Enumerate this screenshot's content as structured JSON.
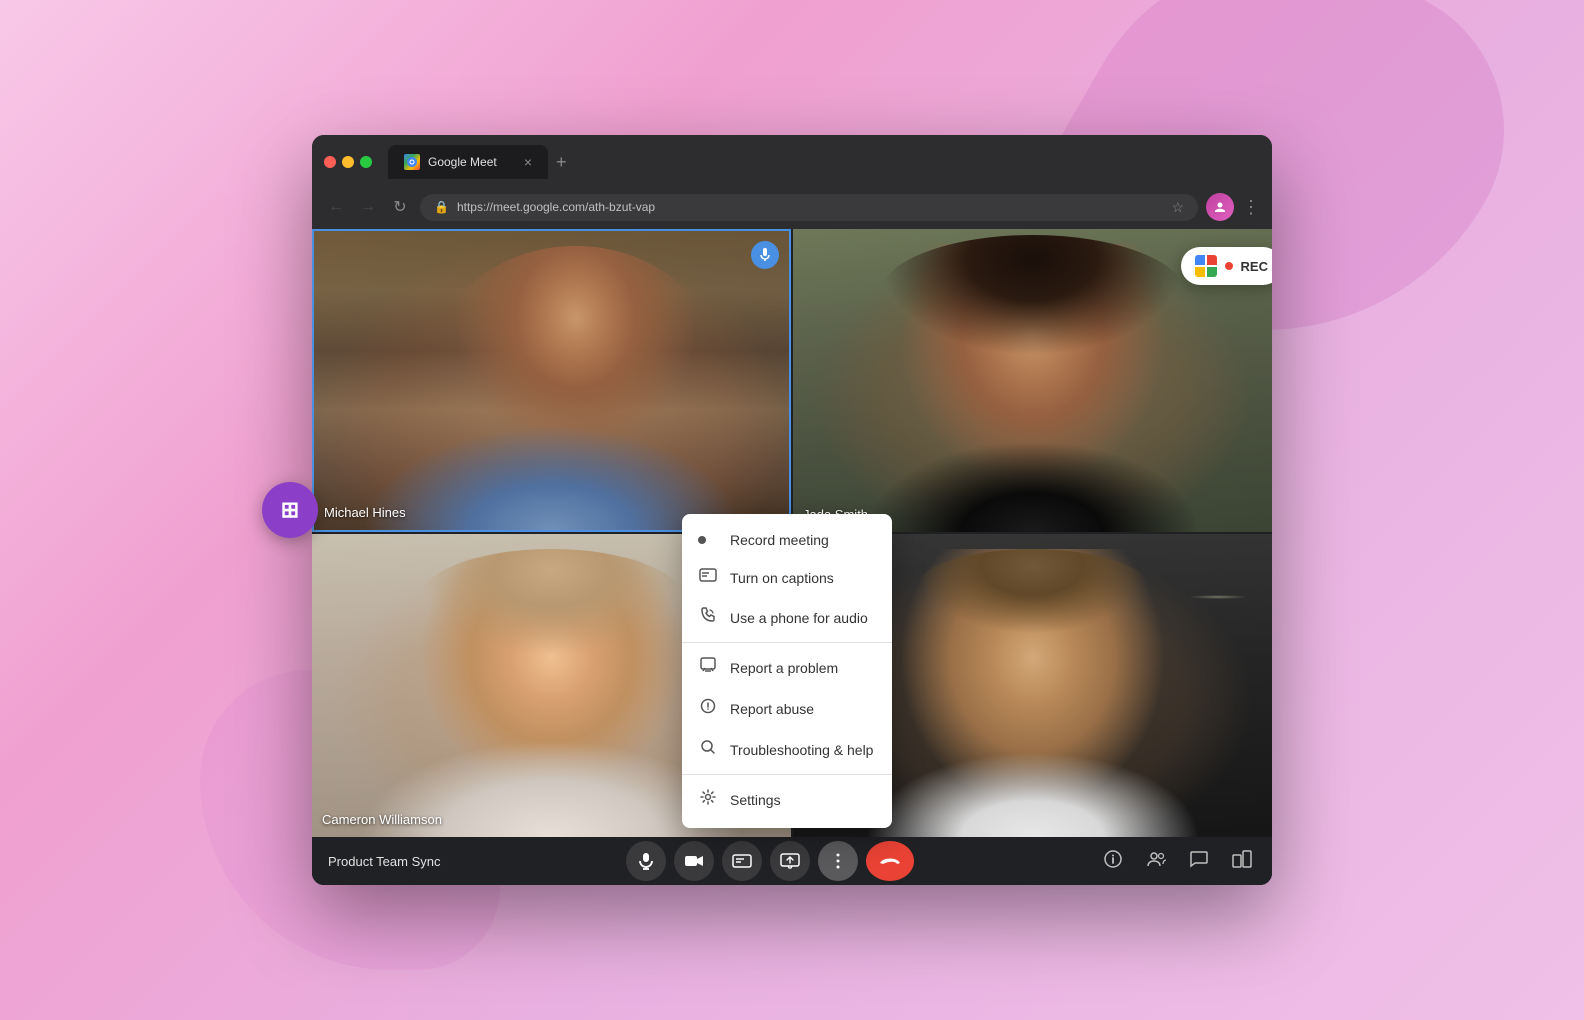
{
  "browser": {
    "tab_title": "Google Meet",
    "url": "https://meet.google.com/ath-bzut-vap",
    "new_tab_label": "+"
  },
  "participants": [
    {
      "name": "Michael Hines",
      "active": true
    },
    {
      "name": "Jada Smith",
      "active": false
    },
    {
      "name": "Cameron Williamson",
      "active": false
    },
    {
      "name": "",
      "active": false
    }
  ],
  "rec_badge": {
    "label": "REC"
  },
  "meeting": {
    "name": "Product Team Sync"
  },
  "menu": {
    "items": [
      {
        "label": "Record meeting",
        "icon": "dot",
        "divider_after": false
      },
      {
        "label": "Turn on captions",
        "icon": "captions",
        "divider_after": false
      },
      {
        "label": "Use a phone for audio",
        "icon": "phone",
        "divider_after": true
      },
      {
        "label": "Report a problem",
        "icon": "flag",
        "divider_after": false
      },
      {
        "label": "Report abuse",
        "icon": "alert",
        "divider_after": false
      },
      {
        "label": "Troubleshooting & help",
        "icon": "search",
        "divider_after": true
      },
      {
        "label": "Settings",
        "icon": "gear",
        "divider_after": false
      }
    ]
  },
  "toolbar": {
    "buttons": [
      "mic",
      "camera",
      "captions",
      "present",
      "more",
      "end"
    ]
  }
}
